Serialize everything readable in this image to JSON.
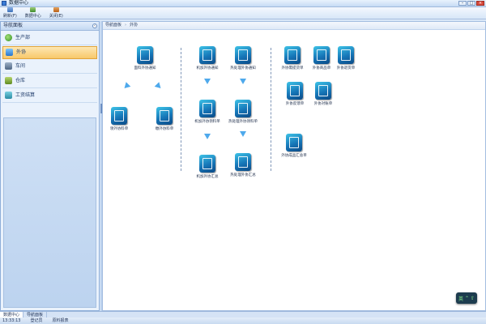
{
  "window": {
    "title": "数据中心",
    "min": "–",
    "max": "□",
    "close": "×"
  },
  "toolbar": [
    {
      "label": "刷新(F)",
      "icon": "refresh-icon"
    },
    {
      "label": "数据中心",
      "icon": "database-icon"
    },
    {
      "label": "关闭(E)",
      "icon": "close-icon"
    }
  ],
  "sidebar": {
    "title": "导航面板",
    "collapse_glyph": "‹",
    "items": [
      {
        "label": "生产部",
        "icon": "department-icon"
      },
      {
        "label": "外协",
        "icon": "outsource-icon"
      },
      {
        "label": "车间",
        "icon": "workshop-icon"
      },
      {
        "label": "仓库",
        "icon": "warehouse-icon"
      },
      {
        "label": "工资结算",
        "icon": "salary-icon"
      }
    ]
  },
  "breadcrumb": {
    "root": "导航面板",
    "current": "外协"
  },
  "flow": {
    "col1": {
      "top": "面料外协通知",
      "left": "领外协料单",
      "right": "缴外协料单"
    },
    "col2": {
      "a1": "机加外协通知",
      "a2": "机加外协领料单",
      "a3": "机加外协汇总",
      "b1": "热处理外协通知",
      "b2": "热处理外协领料单",
      "b3": "热处理外协汇总"
    },
    "col3": {
      "r1": "外协需提货单",
      "r2": "外协商品单",
      "r3": "外协退货单",
      "r4": "外协反馈单",
      "r5": "外协对账单",
      "r6": "外协成品汇总单"
    }
  },
  "widget": {
    "glyph1": "英",
    "glyph2": "⌃",
    "glyph3": "⇧"
  },
  "bottom_tabs": [
    "数据中心",
    "导航面板"
  ],
  "status": {
    "time": "13:33:13",
    "user": "登记员",
    "info": "原料报表"
  }
}
